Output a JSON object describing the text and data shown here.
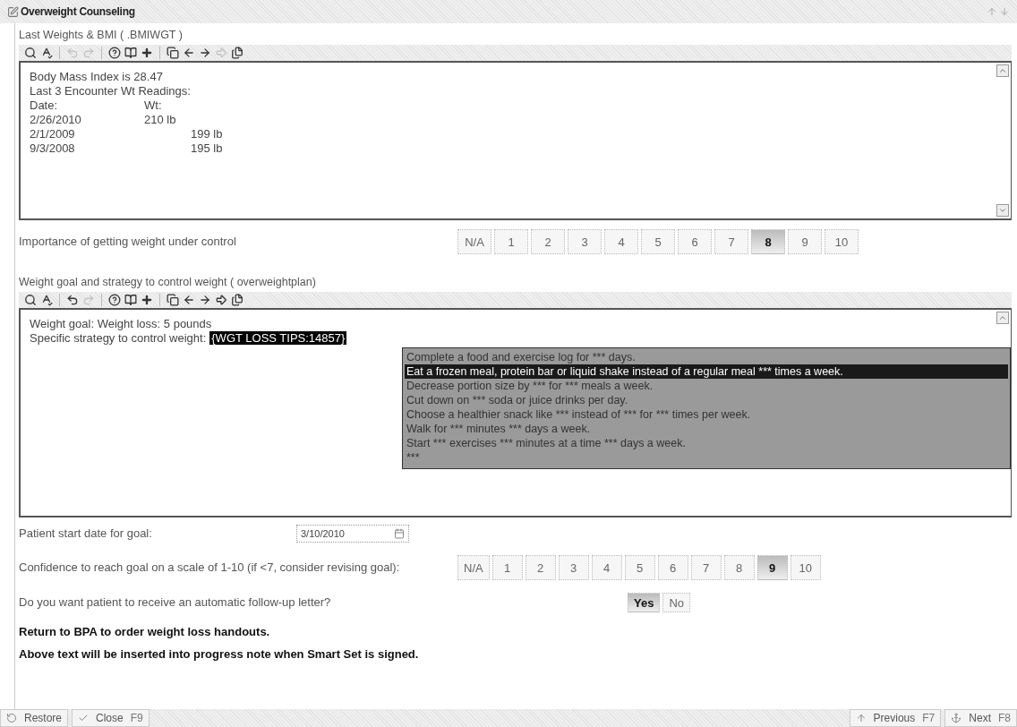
{
  "window": {
    "title": "Overweight Counseling"
  },
  "sections": [
    {
      "label": "Last Weights & BMI ( .BMIWGT )",
      "toolbar": [
        {
          "kind": "search",
          "disabled": false
        },
        {
          "kind": "spellcheck",
          "disabled": false
        },
        {
          "kind": "sep"
        },
        {
          "kind": "undo",
          "disabled": true
        },
        {
          "kind": "redo",
          "disabled": true
        },
        {
          "kind": "sep"
        },
        {
          "kind": "help",
          "disabled": false
        },
        {
          "kind": "mylist",
          "disabled": false
        },
        {
          "kind": "plus",
          "disabled": false
        },
        {
          "kind": "sep"
        },
        {
          "kind": "copy",
          "disabled": false
        },
        {
          "kind": "back",
          "disabled": false
        },
        {
          "kind": "forward",
          "disabled": false
        },
        {
          "kind": "jump",
          "disabled": true
        },
        {
          "kind": "pages",
          "disabled": false
        }
      ],
      "lines": [
        "Body Mass Index is 28.47",
        "Last 3 Encounter Wt Readings:"
      ],
      "table": {
        "columns": [
          "Date:",
          "Wt:"
        ],
        "rows": [
          [
            "2/26/2010",
            "210 lb"
          ],
          [
            "2/1/2009",
            "199 lb"
          ],
          [
            "9/3/2008",
            "195 lb"
          ]
        ]
      }
    },
    {
      "label": "Weight goal and strategy to control weight ( overweightplan)",
      "toolbar": [
        {
          "kind": "search",
          "disabled": false
        },
        {
          "kind": "spellcheck",
          "disabled": false
        },
        {
          "kind": "sep"
        },
        {
          "kind": "undo",
          "disabled": false
        },
        {
          "kind": "redo",
          "disabled": true
        },
        {
          "kind": "sep"
        },
        {
          "kind": "help",
          "disabled": false
        },
        {
          "kind": "mylist",
          "disabled": false
        },
        {
          "kind": "plus",
          "disabled": false
        },
        {
          "kind": "sep"
        },
        {
          "kind": "copy",
          "disabled": false
        },
        {
          "kind": "back",
          "disabled": false
        },
        {
          "kind": "forward",
          "disabled": false
        },
        {
          "kind": "jump",
          "disabled": false
        },
        {
          "kind": "pages",
          "disabled": false
        }
      ],
      "lines": [
        "Weight goal: Weight loss: 5 pounds",
        "Specific strategy to control weight:"
      ],
      "token": "{WGT LOSS TIPS:14857}",
      "dropdown": [
        {
          "label": "Complete a food and exercise log for *** days.",
          "selected": false
        },
        {
          "label": "Eat a frozen meal, protein bar or liquid shake instead of a regular meal *** times a week.",
          "selected": true
        },
        {
          "label": "Decrease portion size by *** for *** meals a week.",
          "selected": false
        },
        {
          "label": "Cut down on *** soda or juice drinks per day.",
          "selected": false
        },
        {
          "label": "Choose a healthier snack like *** instead of *** for *** times per week.",
          "selected": false
        },
        {
          "label": "Walk for *** minutes *** days a week.",
          "selected": false
        },
        {
          "label": "Start *** exercises *** minutes at a time *** days a week.",
          "selected": false
        },
        {
          "label": "***",
          "selected": false
        }
      ]
    }
  ],
  "importance": {
    "label": "Importance of getting weight under control",
    "options": [
      {
        "label": "N/A",
        "selected": false
      },
      {
        "label": "1",
        "selected": false
      },
      {
        "label": "2",
        "selected": false
      },
      {
        "label": "3",
        "selected": false
      },
      {
        "label": "4",
        "selected": false
      },
      {
        "label": "5",
        "selected": false
      },
      {
        "label": "6",
        "selected": false
      },
      {
        "label": "7",
        "selected": false
      },
      {
        "label": "8",
        "selected": true
      },
      {
        "label": "9",
        "selected": false
      },
      {
        "label": "10",
        "selected": false
      }
    ]
  },
  "start_date": {
    "label": "Patient start date for goal:",
    "value": "3/10/2010"
  },
  "confidence": {
    "label": "Confidence to reach goal on a scale of 1-10 (if <7, consider revising goal):",
    "options": [
      {
        "label": "N/A",
        "selected": false
      },
      {
        "label": "1",
        "selected": false
      },
      {
        "label": "2",
        "selected": false
      },
      {
        "label": "3",
        "selected": false
      },
      {
        "label": "4",
        "selected": false
      },
      {
        "label": "5",
        "selected": false
      },
      {
        "label": "6",
        "selected": false
      },
      {
        "label": "7",
        "selected": false
      },
      {
        "label": "8",
        "selected": false
      },
      {
        "label": "9",
        "selected": true
      },
      {
        "label": "10",
        "selected": false
      }
    ]
  },
  "follow_up": {
    "label": "Do you want patient to receive an automatic follow-up letter?",
    "options": [
      {
        "label": "Yes",
        "selected": true
      },
      {
        "label": "No",
        "selected": false
      }
    ]
  },
  "notes": [
    "Return to BPA to order weight loss handouts.",
    "Above text will be inserted into progress note when Smart Set is signed."
  ],
  "bottom_bar": {
    "left": [
      {
        "kind": "restore",
        "label": "Restore"
      },
      {
        "kind": "close",
        "label": "Close",
        "key": "F9"
      }
    ],
    "right": [
      {
        "kind": "previous",
        "label": "Previous",
        "key": "F7"
      },
      {
        "kind": "next",
        "label": "Next",
        "key": "F8"
      }
    ]
  }
}
